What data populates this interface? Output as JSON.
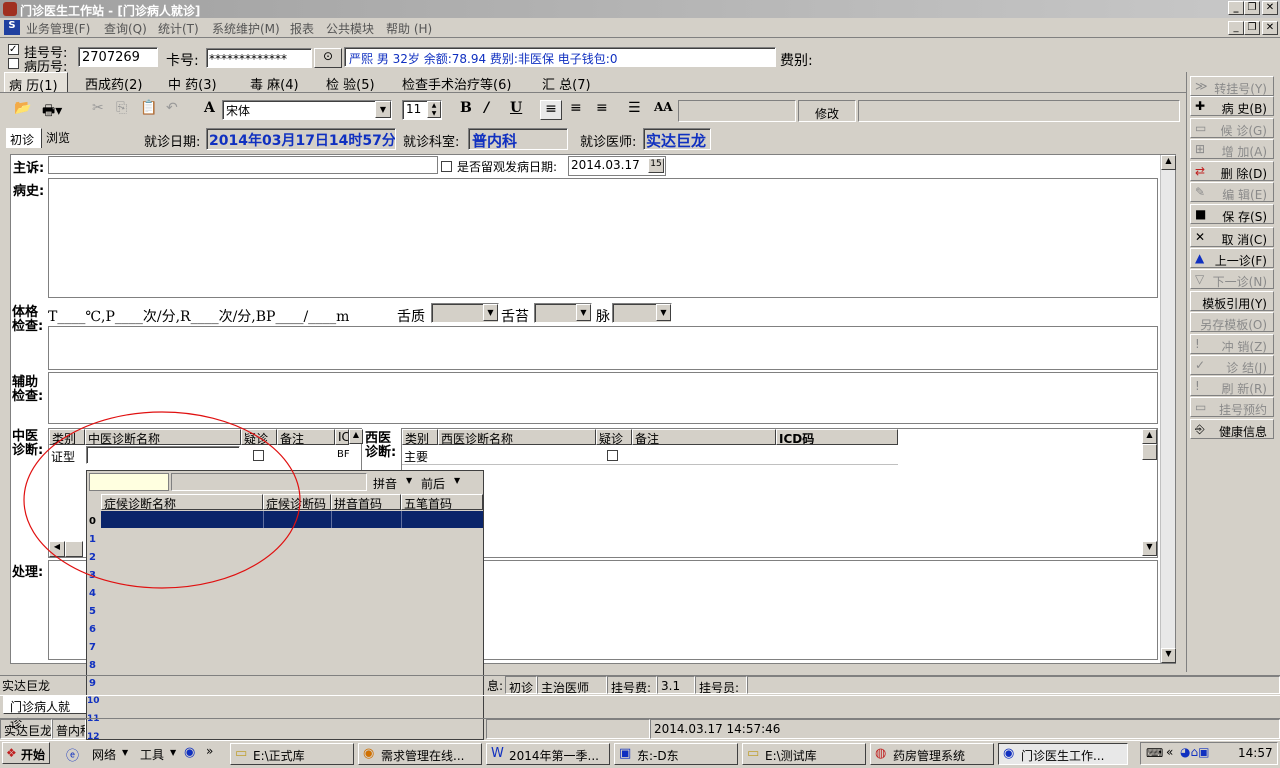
{
  "app": {
    "title": "门诊医生工作站 - [门诊病人就诊]"
  },
  "menu": [
    "业务管理(F)",
    "查询(Q)",
    "统计(T)",
    "系统维护(M)",
    "报表",
    "公共模块",
    "帮助 (H)"
  ],
  "patient_bar": {
    "reg_no_label": "挂号号:",
    "record_no_label": "病历号:",
    "reg_no_value": "2707269",
    "card_label": "卡号:",
    "card_value": "*************",
    "info": "严熙 男 32岁 余额:78.94 费别:非医保 电子钱包:0",
    "fee_type_label": "费别:"
  },
  "tabs": [
    "病 历(1)",
    "西成药(2)",
    "中 药(3)",
    "毒 麻(4)",
    "检 验(5)",
    "检查手术治疗等(6)",
    "汇 总(7)"
  ],
  "toolbar": {
    "font_name": "宋体",
    "font_size": "11",
    "modify_label": "修改",
    "bold": "B",
    "italic": "I",
    "underline": "U"
  },
  "visit": {
    "tab_first": "初诊",
    "tab_browse": "浏览",
    "date_label": "就诊日期:",
    "date_value": "2014年03月17日14时57分",
    "dept_label": "就诊科室:",
    "dept_value": "普内科",
    "doctor_label": "就诊医师:",
    "doctor_value": "实达巨龙"
  },
  "form": {
    "complaint_label": "主诉:",
    "observe_label": "是否留观发病日期:",
    "observe_date": "2014.03.17",
    "history_label": "病史:",
    "exam_label": "体格检查:",
    "vitals_text": "T____℃,P____次/分,R____次/分,BP____/____m",
    "tongue_label": "舌质",
    "coating_label": "舌苔",
    "pulse_label": "脉",
    "aux_label": "辅助检查:",
    "tcm_label": "中医诊断:",
    "wm_label": "西医诊断:",
    "treat_label": "处理:"
  },
  "tcm_grid": {
    "headers": [
      "类别",
      "中医诊断名称",
      "疑诊",
      "备注",
      "IC"
    ],
    "row": {
      "type": "证型",
      "icd_short": "BF"
    }
  },
  "wm_grid": {
    "headers": [
      "类别",
      "西医诊断名称",
      "疑诊",
      "备注",
      "ICD码"
    ],
    "row": {
      "type": "主要"
    }
  },
  "popup": {
    "pinyin_label": "拼音",
    "order_label": "前后",
    "headers": [
      "症候诊断名称",
      "症候诊断码",
      "拼音首码",
      "五笔首码"
    ],
    "row_numbers": [
      "0",
      "1",
      "2",
      "3",
      "4",
      "5",
      "6",
      "7",
      "8",
      "9",
      "10",
      "11",
      "12"
    ]
  },
  "sidebar": [
    {
      "label": "转挂号(Y)",
      "icon": "transfer-icon",
      "enabled": false
    },
    {
      "label": "病 史(B)",
      "icon": "plus-icon",
      "enabled": true
    },
    {
      "label": "候 诊(G)",
      "icon": "document-icon",
      "enabled": false
    },
    {
      "label": "增 加(A)",
      "icon": "add-icon",
      "enabled": false
    },
    {
      "label": "删 除(D)",
      "icon": "delete-icon",
      "enabled": true
    },
    {
      "label": "编 辑(E)",
      "icon": "edit-icon",
      "enabled": false
    },
    {
      "label": "保 存(S)",
      "icon": "save-icon",
      "enabled": true
    },
    {
      "label": "取 消(C)",
      "icon": "cancel-icon",
      "enabled": true
    },
    {
      "label": "上一诊(F)",
      "icon": "up-icon",
      "enabled": true
    },
    {
      "label": "下一诊(N)",
      "icon": "down-icon",
      "enabled": false
    },
    {
      "label": "模板引用(Y)",
      "icon": "",
      "enabled": true
    },
    {
      "label": "另存模板(O)",
      "icon": "",
      "enabled": false
    },
    {
      "label": "冲 销(Z)",
      "icon": "reverse-icon",
      "enabled": false
    },
    {
      "label": "诊 结(J)",
      "icon": "check-icon",
      "enabled": false
    },
    {
      "label": "刷 新(R)",
      "icon": "refresh-icon",
      "enabled": false
    },
    {
      "label": "挂号预约",
      "icon": "calendar-icon",
      "enabled": false
    },
    {
      "label": "健康信息",
      "icon": "health-icon",
      "enabled": true
    }
  ],
  "status": {
    "operator": "实达巨龙",
    "info_suffix": "息:",
    "visit_type": "初诊",
    "doctor_role": "主治医师",
    "fee_label": "挂号费:",
    "fee_value": "3.1",
    "registrar_label": "挂号员:",
    "window_tab": "门诊病人就诊",
    "bottom_user": "实达巨龙",
    "bottom_dept": "普内科",
    "datetime": "2014.03.17 14:57:46"
  },
  "taskbar": {
    "start": "开始",
    "network": "网络",
    "tools": "工具",
    "items": [
      "E:\\正式库",
      "需求管理在线...",
      "2014年第一季...",
      "东:-D东",
      "E:\\测试库",
      "药房管理系统",
      "门诊医生工作..."
    ],
    "clock": "14:57"
  },
  "colors": {
    "accent_blue": "#1030c0",
    "selection": "#0a246a",
    "annotation_red": "#e01010"
  }
}
